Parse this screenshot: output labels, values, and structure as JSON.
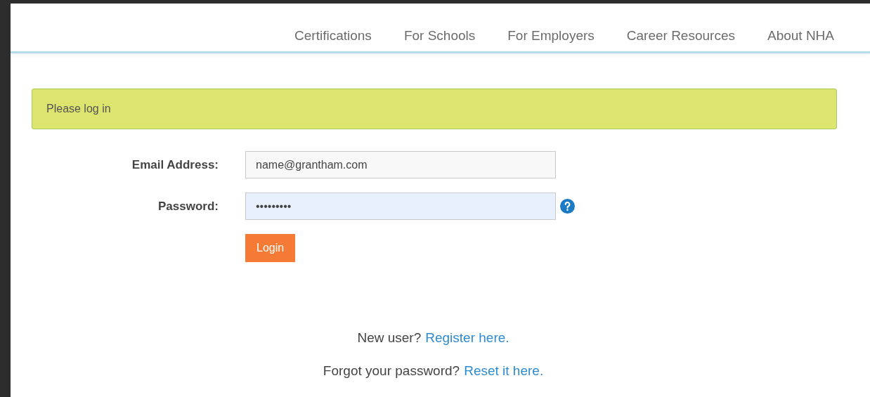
{
  "nav": {
    "items": [
      {
        "label": "Certifications"
      },
      {
        "label": "For Schools"
      },
      {
        "label": "For Employers"
      },
      {
        "label": "Career Resources"
      },
      {
        "label": "About NHA"
      }
    ]
  },
  "alert": {
    "text": "Please log in"
  },
  "form": {
    "fields": [
      {
        "label": "Email Address:",
        "value": "name@grantham.com",
        "focused": false,
        "help": false
      },
      {
        "label": "Password:",
        "value": "•••••••••",
        "focused": true,
        "help": true
      }
    ],
    "submit": "Login"
  },
  "links": [
    {
      "text": "New user?",
      "link": "Register here."
    },
    {
      "text": "Forgot your password?",
      "link": "Reset it here."
    }
  ]
}
